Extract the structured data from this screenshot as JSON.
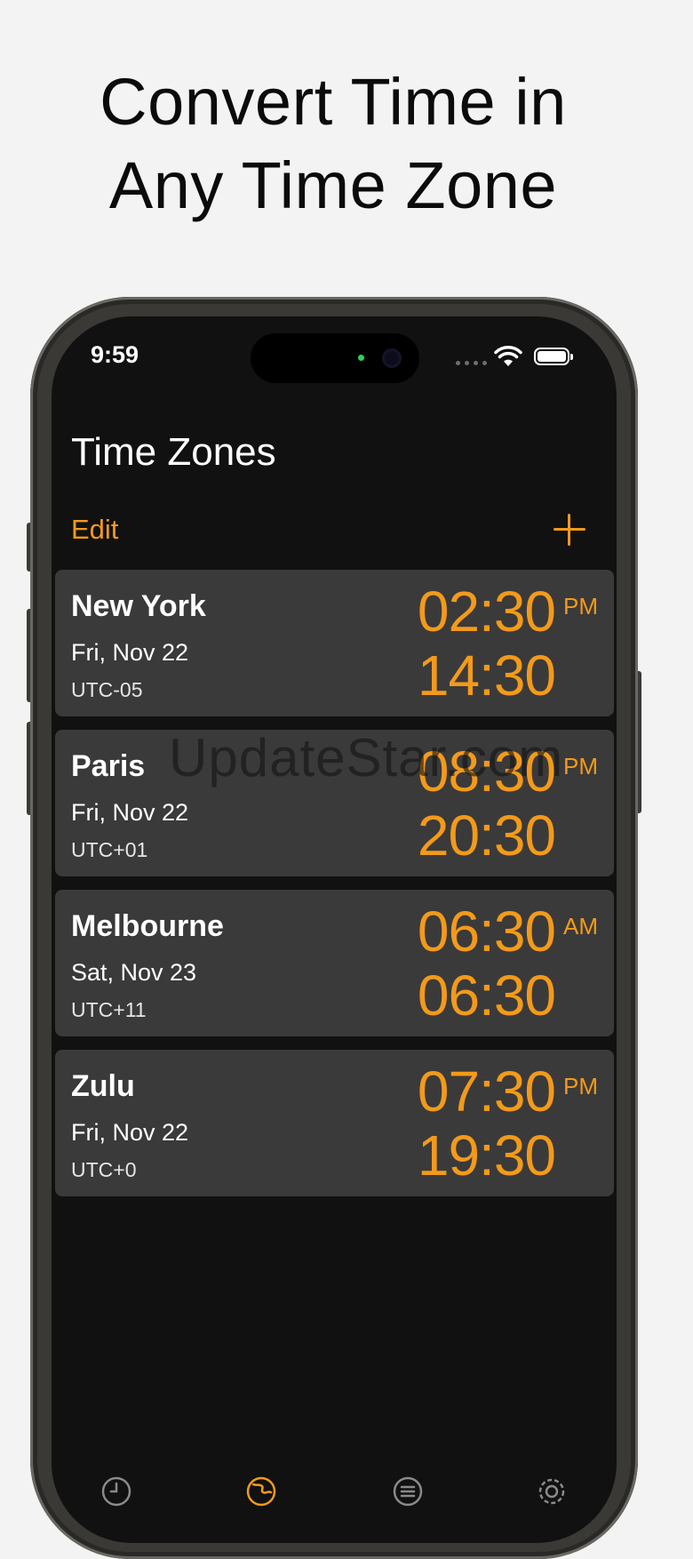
{
  "headline": {
    "line1": "Convert Time in",
    "line2": "Any Time Zone"
  },
  "status_bar": {
    "time": "9:59"
  },
  "nav": {
    "title": "Time Zones",
    "edit_label": "Edit",
    "add_icon": "plus-icon"
  },
  "zones": [
    {
      "city": "New York",
      "date": "Fri, Nov 22",
      "utc": "UTC-05",
      "time12": "02:30",
      "ampm": "PM",
      "time24": "14:30"
    },
    {
      "city": "Paris",
      "date": "Fri, Nov 22",
      "utc": "UTC+01",
      "time12": "08:30",
      "ampm": "PM",
      "time24": "20:30"
    },
    {
      "city": "Melbourne",
      "date": "Sat, Nov 23",
      "utc": "UTC+11",
      "time12": "06:30",
      "ampm": "AM",
      "time24": "06:30"
    },
    {
      "city": "Zulu",
      "date": "Fri, Nov 22",
      "utc": "UTC+0",
      "time12": "07:30",
      "ampm": "PM",
      "time24": "19:30"
    }
  ],
  "watermark": "UpdateStar.com",
  "tab_bar": {
    "icons": [
      "clock-icon",
      "globe-icon",
      "list-icon",
      "gear-icon"
    ],
    "active": "globe-icon"
  },
  "colors": {
    "accent": "#f39a1b",
    "screen_bg": "#111111",
    "card_bg": "#3a3a3a",
    "page_bg": "#f3f3f3"
  }
}
